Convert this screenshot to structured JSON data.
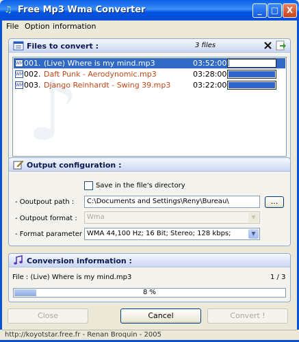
{
  "window": {
    "title": "Free Mp3 Wma Converter",
    "minimize": "_",
    "maximize": "□",
    "close": "X"
  },
  "menu": {
    "items": [
      "File",
      "Option",
      "information"
    ]
  },
  "files_panel": {
    "title": "Files to convert :",
    "count": "3 files",
    "files": [
      {
        "num": "001.",
        "name": "(Live) Where is my mind.mp3",
        "duration": "03:52:00",
        "progress": 0.02,
        "selected": true
      },
      {
        "num": "002.",
        "name": "Daft Punk - Aerodynomic.mp3",
        "duration": "03:28:00",
        "progress": 1.0,
        "selected": false
      },
      {
        "num": "003.",
        "name": "Django Reinhardt - Swing 39.mp3",
        "duration": "03:22:00",
        "progress": 1.0,
        "selected": false
      }
    ]
  },
  "output_panel": {
    "title": "Output configuration :",
    "save_in_dir_label": "Save in the file's directory",
    "path_label": "- Ooutpout path :",
    "path_value": "C:\\Documents and Settings\\Reny\\Bureau\\",
    "browse_label": "...",
    "format_label": "- Outpout format :",
    "format_value": "Wma",
    "param_label": "- Format parameter :",
    "param_value": "WMA 44,100 Hz; 16 Bit; Stereo; 128 kbps;"
  },
  "conversion_panel": {
    "title": "Conversion information :",
    "file_text": "File : (Live) Where is my mind.mp3",
    "counter": "1 / 3",
    "percent_text": "8 %",
    "percent": 0.08
  },
  "buttons": {
    "close": "Close",
    "cancel": "Cancel",
    "convert": "Convert !"
  },
  "status": {
    "text": "http://koyotstar.free.fr - Renan Broquin - 2005"
  }
}
